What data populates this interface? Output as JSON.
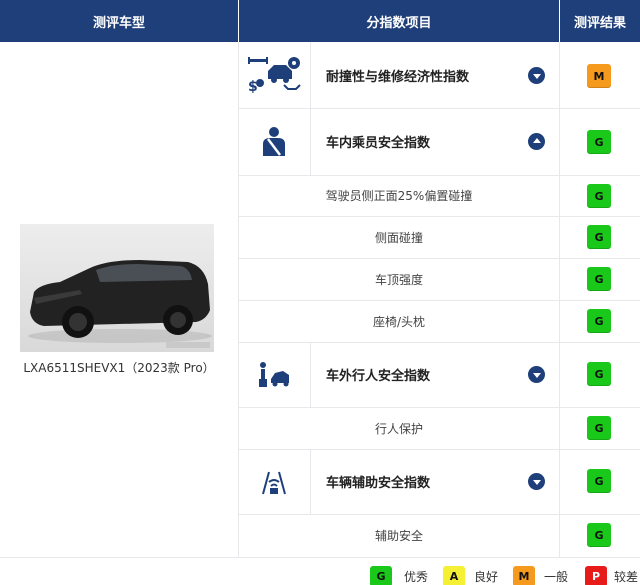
{
  "header": {
    "col1": "测评车型",
    "col2": "分指数项目",
    "col3": "测评结果"
  },
  "vehicle": {
    "name": "LXA6511SHEVX1（2023款 Pro）"
  },
  "indices": [
    {
      "label": "耐撞性与维修经济性指数",
      "icon": "crash-repair-icon",
      "toggle": "collapsed",
      "rating": "M",
      "items": []
    },
    {
      "label": "车内乘员安全指数",
      "icon": "seatbelt-occupant-icon",
      "toggle": "expanded",
      "rating": "G",
      "items": [
        {
          "label": "驾驶员侧正面25%偏置碰撞",
          "rating": "G"
        },
        {
          "label": "侧面碰撞",
          "rating": "G"
        },
        {
          "label": "车顶强度",
          "rating": "G"
        },
        {
          "label": "座椅/头枕",
          "rating": "G"
        }
      ]
    },
    {
      "label": "车外行人安全指数",
      "icon": "pedestrian-icon",
      "toggle": "collapsed",
      "rating": "G",
      "items": [
        {
          "label": "行人保护",
          "rating": "G"
        }
      ]
    },
    {
      "label": "车辆辅助安全指数",
      "icon": "driver-assist-icon",
      "toggle": "collapsed",
      "rating": "G",
      "items": [
        {
          "label": "辅助安全",
          "rating": "G"
        }
      ]
    }
  ],
  "legend": [
    {
      "code": "G",
      "text": "优秀",
      "color": "#19c819"
    },
    {
      "code": "A",
      "text": "良好",
      "color": "#f5f034"
    },
    {
      "code": "M",
      "text": "一般",
      "color": "#f59a1c"
    },
    {
      "code": "P",
      "text": "较差",
      "color": "#e81b1b"
    }
  ],
  "colors": {
    "header_bg": "#1e3f7a",
    "rating_G": "#19c819",
    "rating_M": "#f59a1c"
  }
}
